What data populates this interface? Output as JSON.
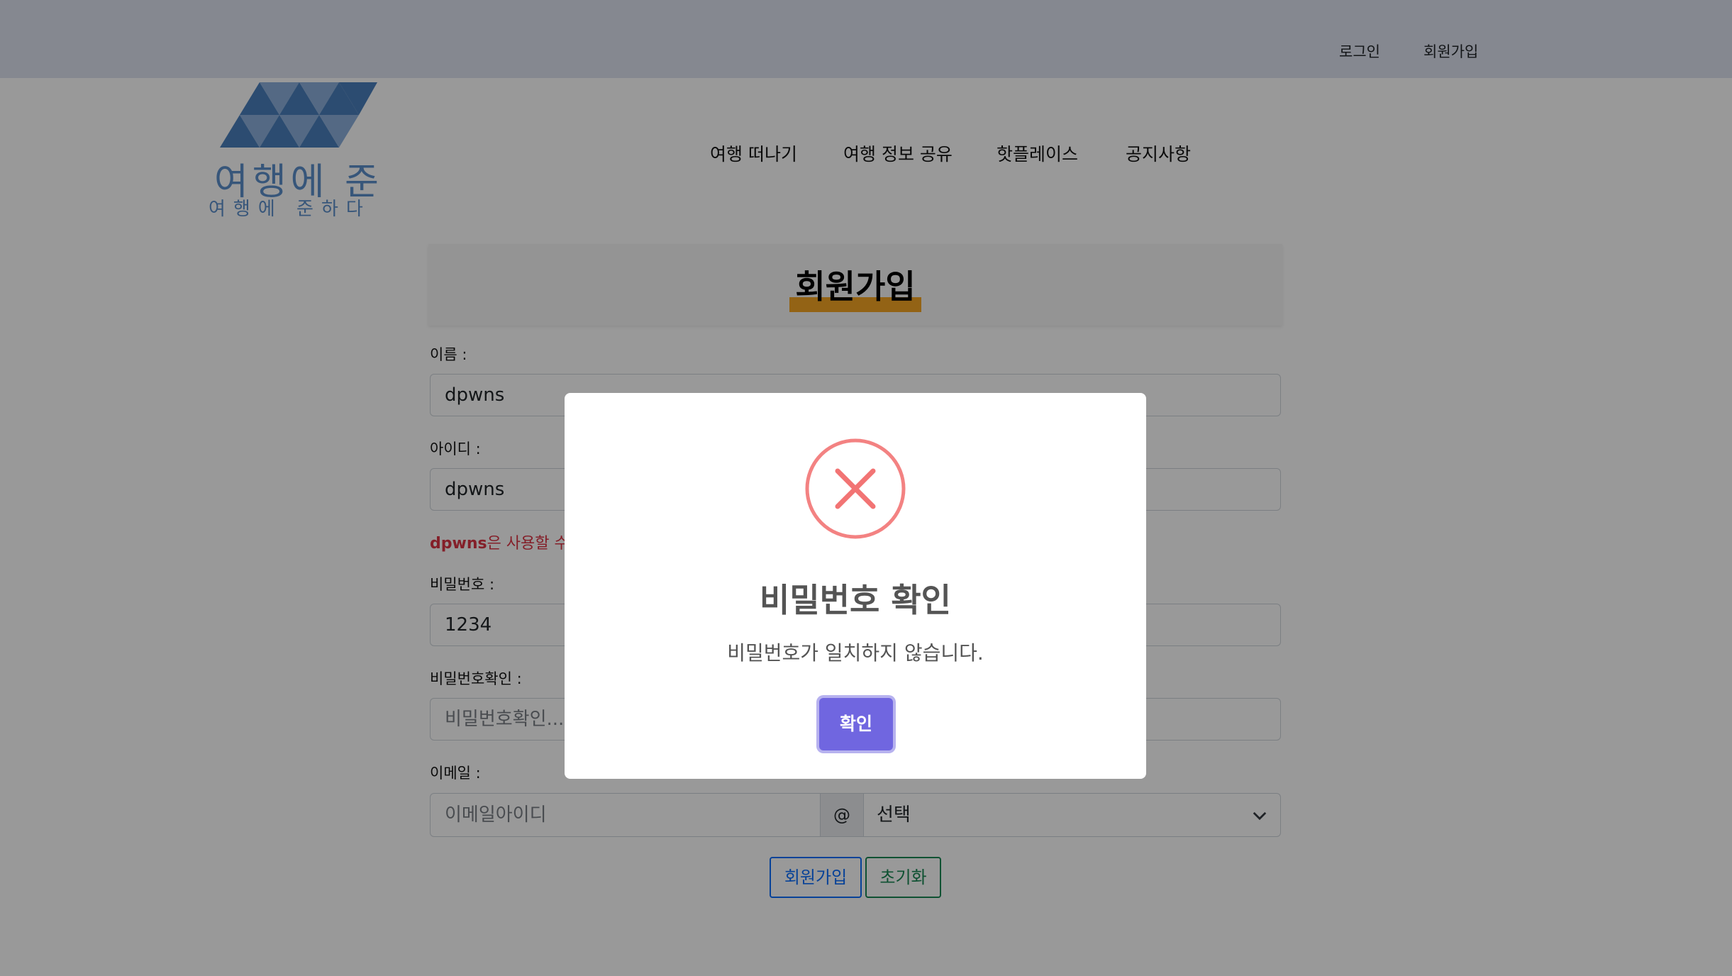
{
  "topbar": {
    "login": "로그인",
    "signup": "회원가입"
  },
  "logo": {
    "main": "여행에 준",
    "sub": "여행에 준하다",
    "color": "#5d8fcc"
  },
  "nav": [
    "여행 떠나기",
    "여행 정보 공유",
    "핫플레이스",
    "공지사항"
  ],
  "page": {
    "title": "회원가입"
  },
  "form": {
    "name": {
      "label": "이름 :",
      "value": "dpwns"
    },
    "userid": {
      "label": "아이디 :",
      "value": "dpwns"
    },
    "id_error": {
      "id": "dpwns",
      "text": "은 사용할 수 없"
    },
    "password": {
      "label": "비밀번호 :",
      "value": "1234"
    },
    "password_confirm": {
      "label": "비밀번호확인 :",
      "placeholder": "비밀번호확인..."
    },
    "email": {
      "label": "이메일 :",
      "placeholder": "이메일아이디",
      "at": "@",
      "domain_selected": "선택"
    },
    "submit_label": "회원가입",
    "reset_label": "초기화"
  },
  "modal": {
    "icon": "error-x-icon",
    "title": "비밀번호 확인",
    "text": "비밀번호가 일치하지 않습니다.",
    "confirm_label": "확인",
    "confirm_color": "#7066e0",
    "icon_color": "#f27474"
  }
}
